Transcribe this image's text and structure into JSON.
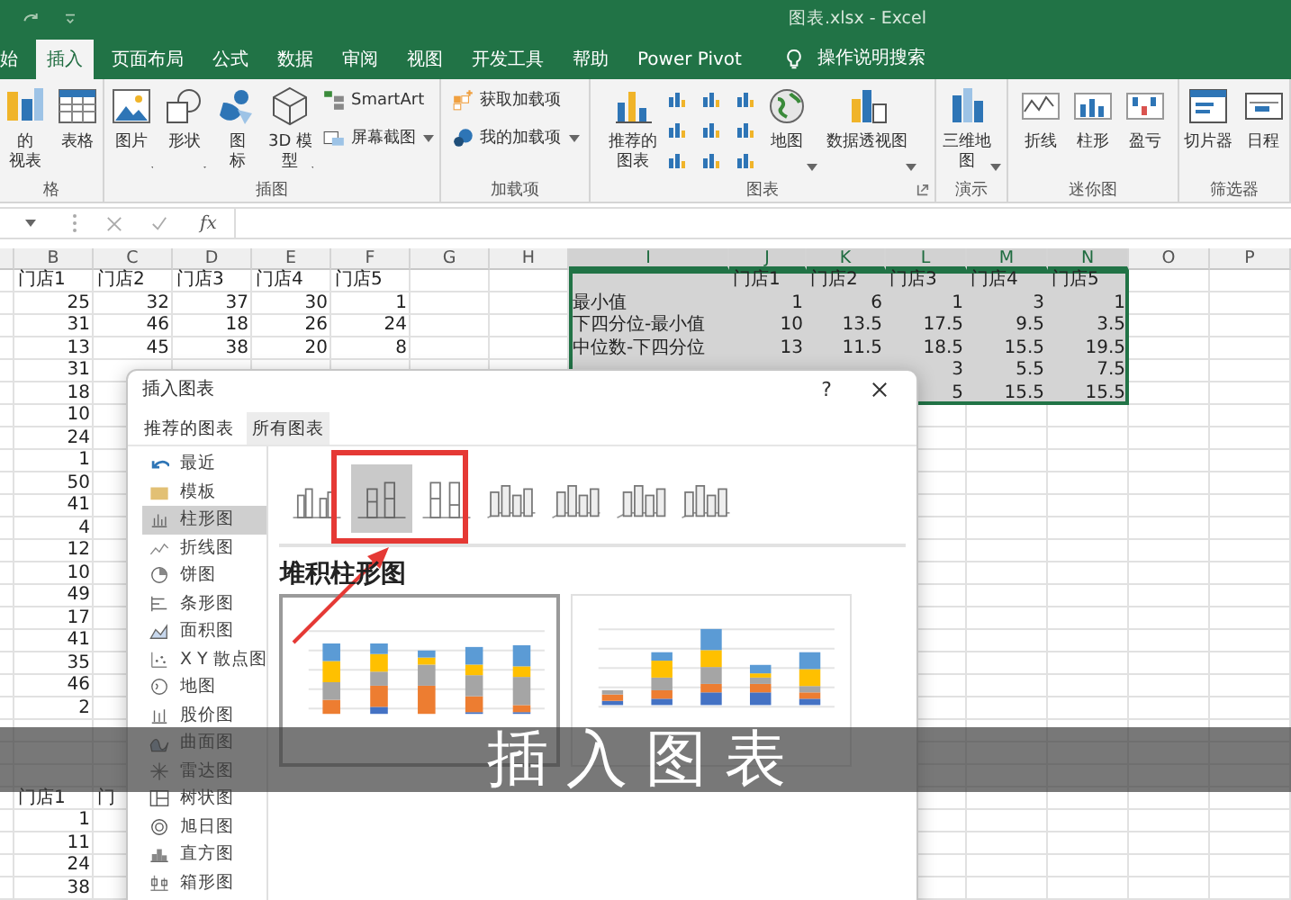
{
  "window": {
    "title": "图表.xlsx - Excel"
  },
  "ribbon_tabs": [
    {
      "label": "始",
      "selected": false
    },
    {
      "label": "插入",
      "selected": true
    },
    {
      "label": "页面布局",
      "selected": false
    },
    {
      "label": "公式",
      "selected": false
    },
    {
      "label": "数据",
      "selected": false
    },
    {
      "label": "审阅",
      "selected": false
    },
    {
      "label": "视图",
      "selected": false
    },
    {
      "label": "开发工具",
      "selected": false
    },
    {
      "label": "帮助",
      "selected": false
    },
    {
      "label": "Power Pivot",
      "selected": false
    }
  ],
  "tell_me": {
    "placeholder": "操作说明搜索"
  },
  "ribbon_groups": [
    {
      "label": "格",
      "items": [
        {
          "kind": "large",
          "lines": [
            "的",
            "视表"
          ]
        },
        {
          "kind": "large",
          "lines": [
            "表格"
          ]
        }
      ]
    },
    {
      "label": "插图",
      "items": [
        {
          "kind": "large",
          "lines": [
            "图片"
          ],
          "dropdown": true
        },
        {
          "kind": "large",
          "lines": [
            "形状"
          ],
          "dropdown": true
        },
        {
          "kind": "large",
          "lines": [
            "图",
            "标"
          ]
        },
        {
          "kind": "large",
          "lines": [
            "3D 模",
            "型"
          ],
          "dropdown": true
        },
        {
          "kind": "stack",
          "entries": [
            {
              "label": "SmartArt"
            },
            {
              "label": "屏幕截图",
              "dropdown": true
            }
          ]
        }
      ]
    },
    {
      "label": "加载项",
      "items": [
        {
          "kind": "stack",
          "entries": [
            {
              "label": "获取加载项"
            },
            {
              "label": "我的加载项",
              "dropdown": true
            }
          ]
        }
      ]
    },
    {
      "label": "图表",
      "launcher": true,
      "items": [
        {
          "kind": "large",
          "lines": [
            "推荐的",
            "图表"
          ]
        },
        {
          "kind": "icon_grid"
        },
        {
          "kind": "large",
          "lines": [
            "地图"
          ],
          "dropdown": true
        },
        {
          "kind": "large",
          "lines": [
            "数据透视图"
          ],
          "dropdown": true
        }
      ]
    },
    {
      "label": "演示",
      "items": [
        {
          "kind": "large",
          "lines": [
            "三维地",
            "图"
          ],
          "dropdown": true
        }
      ]
    },
    {
      "label": "迷你图",
      "items": [
        {
          "kind": "large",
          "lines": [
            "折线"
          ]
        },
        {
          "kind": "large",
          "lines": [
            "柱形"
          ]
        },
        {
          "kind": "large",
          "lines": [
            "盈亏"
          ]
        }
      ]
    },
    {
      "label": "筛选器",
      "items": [
        {
          "kind": "large",
          "lines": [
            "切片器"
          ]
        },
        {
          "kind": "large",
          "lines": [
            "日程"
          ]
        }
      ]
    }
  ],
  "formula_bar": {
    "function_label": "fx"
  },
  "sheet": {
    "columns": [
      {
        "letter": "B",
        "selected": false
      },
      {
        "letter": "C",
        "selected": false
      },
      {
        "letter": "D",
        "selected": false
      },
      {
        "letter": "E",
        "selected": false
      },
      {
        "letter": "F",
        "selected": false
      },
      {
        "letter": "G",
        "selected": false
      },
      {
        "letter": "H",
        "selected": false
      },
      {
        "letter": "I",
        "selected": true
      },
      {
        "letter": "J",
        "selected": true
      },
      {
        "letter": "K",
        "selected": true
      },
      {
        "letter": "L",
        "selected": true
      },
      {
        "letter": "M",
        "selected": true
      },
      {
        "letter": "N",
        "selected": true
      },
      {
        "letter": "O",
        "selected": false
      },
      {
        "letter": "P",
        "selected": false
      }
    ],
    "rows": [
      {
        "selected": true,
        "cells": [
          "门店1",
          "门店2",
          "门店3",
          "门店4",
          "门店5",
          null,
          null,
          null,
          "门店1",
          "门店2",
          "门店3",
          "门店4",
          "门店5"
        ]
      },
      {
        "selected": true,
        "cells": [
          "25",
          "32",
          "37",
          "30",
          "1",
          null,
          null,
          "最小值",
          "1",
          "6",
          "1",
          "3",
          "1"
        ]
      },
      {
        "selected": true,
        "cells": [
          "31",
          "46",
          "18",
          "26",
          "24",
          null,
          null,
          "下四分位-最小值",
          "10",
          "13.5",
          "17.5",
          "9.5",
          "3.5"
        ]
      },
      {
        "selected": true,
        "cells": [
          "13",
          "45",
          "38",
          "20",
          "8",
          null,
          null,
          "中位数-下四分位",
          "13",
          "11.5",
          "18.5",
          "15.5",
          "19.5"
        ]
      },
      {
        "selected": true,
        "cells": [
          "31",
          null,
          null,
          null,
          null,
          null,
          null,
          null,
          null,
          null,
          "3",
          "5.5",
          "7.5"
        ]
      },
      {
        "selected": true,
        "cells": [
          "18",
          null,
          null,
          null,
          null,
          null,
          null,
          null,
          null,
          null,
          "5",
          "15.5",
          "15.5"
        ]
      },
      {
        "cells": [
          "10"
        ]
      },
      {
        "cells": [
          "24"
        ]
      },
      {
        "cells": [
          "1"
        ]
      },
      {
        "cells": [
          "50"
        ]
      },
      {
        "cells": [
          "41"
        ]
      },
      {
        "cells": [
          "4"
        ]
      },
      {
        "cells": [
          "12"
        ]
      },
      {
        "cells": [
          "10"
        ]
      },
      {
        "cells": [
          "49"
        ]
      },
      {
        "cells": [
          "17"
        ]
      },
      {
        "cells": [
          "41"
        ]
      },
      {
        "cells": [
          "35"
        ]
      },
      {
        "cells": [
          "46"
        ]
      },
      {
        "cells": [
          "2"
        ]
      },
      {},
      {},
      {},
      {
        "cells": [
          "门店1",
          "门"
        ]
      },
      {
        "cells": [
          "1"
        ]
      },
      {
        "cells": [
          "11"
        ]
      },
      {
        "cells": [
          "24"
        ]
      },
      {
        "cells": [
          "38"
        ]
      }
    ]
  },
  "dialog": {
    "title": "插入图表",
    "help": "?",
    "tabs": [
      {
        "label": "推荐的图表",
        "selected": false
      },
      {
        "label": "所有图表",
        "selected": true
      }
    ],
    "chart_types": [
      {
        "label": "最近",
        "selected": false
      },
      {
        "label": "模板",
        "selected": false
      },
      {
        "label": "柱形图",
        "selected": true
      },
      {
        "label": "折线图",
        "selected": false
      },
      {
        "label": "饼图",
        "selected": false
      },
      {
        "label": "条形图",
        "selected": false
      },
      {
        "label": "面积图",
        "selected": false
      },
      {
        "label": "X Y 散点图",
        "selected": false
      },
      {
        "label": "地图",
        "selected": false
      },
      {
        "label": "股价图",
        "selected": false
      },
      {
        "label": "曲面图",
        "selected": false
      },
      {
        "label": "雷达图",
        "selected": false
      },
      {
        "label": "树状图",
        "selected": false
      },
      {
        "label": "旭日图",
        "selected": false
      },
      {
        "label": "直方图",
        "selected": false
      },
      {
        "label": "箱形图",
        "selected": false
      }
    ],
    "subtypes": [
      {
        "selected": false
      },
      {
        "selected": true
      },
      {
        "selected": false
      },
      {
        "selected": false
      },
      {
        "selected": false
      },
      {
        "selected": false
      },
      {
        "selected": false
      }
    ],
    "subtype_title": "堆积柱形图",
    "previews": [
      {
        "selected": true
      },
      {
        "selected": false
      }
    ]
  },
  "caption": "插入图表"
}
